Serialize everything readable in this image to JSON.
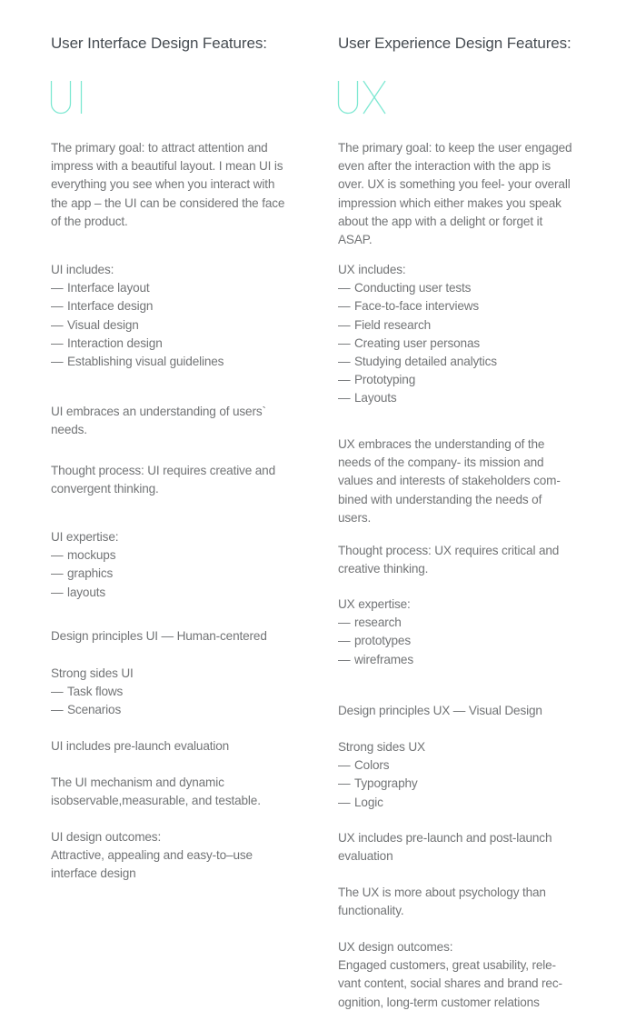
{
  "colors": {
    "accent": "#7ee8d2",
    "heading": "#464c52",
    "body": "#727476"
  },
  "ui": {
    "heading": "User Interface Design Features:",
    "big_label": "UI",
    "primary_goal": [
      "The primary goal: to attract attention and",
      "impress with a beautiful layout. I mean UI is",
      "everything you see when you interact with",
      "the app – the UI can be considered the face",
      "of the product."
    ],
    "includes_title": "UI includes:",
    "includes": [
      "Interface layout",
      "Interface design",
      "Visual design",
      "Interaction design",
      "Establishing visual guidelines"
    ],
    "embraces": [
      "UI embraces an understanding of users`",
      "needs."
    ],
    "thought": [
      "Thought process: UI requires creative and",
      "convergent thinking."
    ],
    "expertise_title": "UI expertise:",
    "expertise": [
      "mockups",
      "graphics",
      "layouts"
    ],
    "principles": "Design principles UI — Human-centered",
    "strong_title": "Strong sides UI",
    "strong": [
      "Task flows",
      "Scenarios"
    ],
    "evaluation": [
      "UI includes pre-launch evaluation"
    ],
    "mechanism": [
      "The UI mechanism and dynamic",
      "isobservable,measurable, and testable."
    ],
    "outcomes_title": "UI design outcomes:",
    "outcomes": [
      "Attractive, appealing and easy-to–use",
      "interface design"
    ]
  },
  "ux": {
    "heading": "User Experience Design Features:",
    "big_label": "UX",
    "primary_goal": [
      "The primary goal: to keep the user engaged",
      "even after the interaction with the app is",
      "over. UX is something you feel- your overall",
      "impression which either makes you speak",
      "about the app with a delight or forget it",
      "ASAP."
    ],
    "includes_title": "UX includes:",
    "includes": [
      "Conducting user tests",
      "Face-to-face interviews",
      "Field research",
      "Creating user personas",
      "Studying detailed analytics",
      "Prototyping",
      "Layouts"
    ],
    "embraces": [
      "UX embraces the understanding of the",
      "needs of the company- its mission and",
      "values and interests of stakeholders com-",
      "bined with understanding the needs of",
      "users."
    ],
    "thought": [
      "Thought process: UX requires critical and",
      "creative thinking."
    ],
    "expertise_title": "UX expertise:",
    "expertise": [
      "research",
      "prototypes",
      "wireframes"
    ],
    "principles": "Design principles UX — Visual Design",
    "strong_title": "Strong sides UX",
    "strong": [
      "Colors",
      "Typography",
      "Logic"
    ],
    "evaluation": [
      "UX includes pre-launch and post-launch",
      "evaluation"
    ],
    "psychology": [
      "The UX is more about psychology than",
      "functionality."
    ],
    "outcomes_title": "UX design outcomes:",
    "outcomes": [
      "Engaged customers, great usability, rele-",
      "vant content, social shares and brand rec-",
      "ognition, long-term customer relations"
    ]
  },
  "dash": "—"
}
